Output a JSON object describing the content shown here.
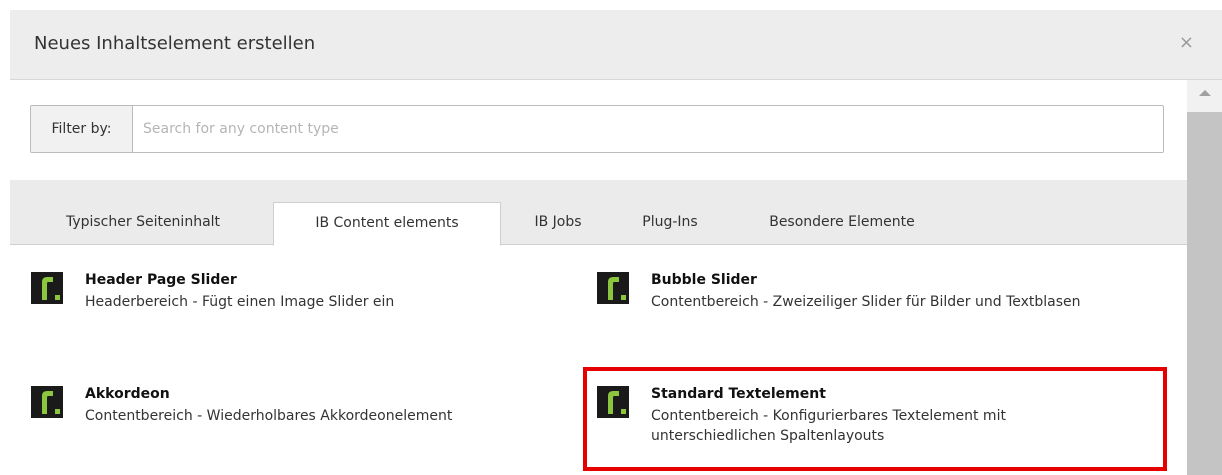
{
  "modal": {
    "title": "Neues Inhaltselement erstellen",
    "close_label": "×"
  },
  "filter": {
    "label": "Filter by:",
    "placeholder": "Search for any content type",
    "value": ""
  },
  "tabs": [
    {
      "label": "Typischer Seiteninhalt",
      "active": false
    },
    {
      "label": "IB Content elements",
      "active": true
    },
    {
      "label": "IB Jobs",
      "active": false
    },
    {
      "label": "Plug-Ins",
      "active": false
    },
    {
      "label": "Besondere Elemente",
      "active": false
    }
  ],
  "elements": [
    {
      "title": "Header Page Slider",
      "description": "Headerbereich - Fügt einen Image Slider ein"
    },
    {
      "title": "Bubble Slider",
      "description": "Contentbereich - Zweizeiliger Slider für Bilder und Textblasen"
    },
    {
      "title": "Akkordeon",
      "description": "Contentbereich - Wiederholbares Akkordeonelement"
    },
    {
      "title": "Standard Textelement",
      "description": "Contentbereich - Konfigurierbares Textelement mit unterschiedlichen Spaltenlayouts",
      "highlighted": true
    }
  ],
  "icons": {
    "element": "content-element-icon",
    "close": "close-icon",
    "scroll_up": "scroll-up-arrow-icon"
  },
  "colors": {
    "highlight": "#e60000",
    "icon_background": "#1a1a1a",
    "icon_accent": "#8cc63f"
  }
}
